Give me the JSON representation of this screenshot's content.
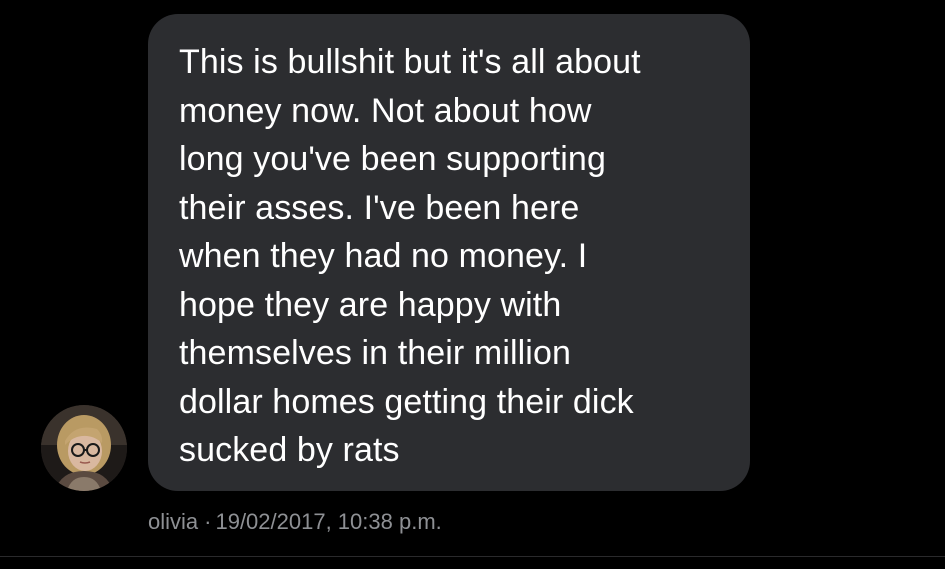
{
  "message": {
    "text": "This is bullshit but it's all about\nmoney now. Not about how\nlong you've been supporting\ntheir asses. I've been here\nwhen they had no money. I\nhope they are happy with\nthemselves in their million\ndollar homes getting their dick\nsucked by rats"
  },
  "sender": {
    "name": "olivia",
    "separator": "·",
    "timestamp": "19/02/2017, 10:38 p.m.",
    "avatar_icon": "user-avatar-photo"
  },
  "colors": {
    "background": "#000000",
    "bubble": "#2c2d30",
    "text": "#ffffff",
    "meta_text": "#8e9094"
  }
}
